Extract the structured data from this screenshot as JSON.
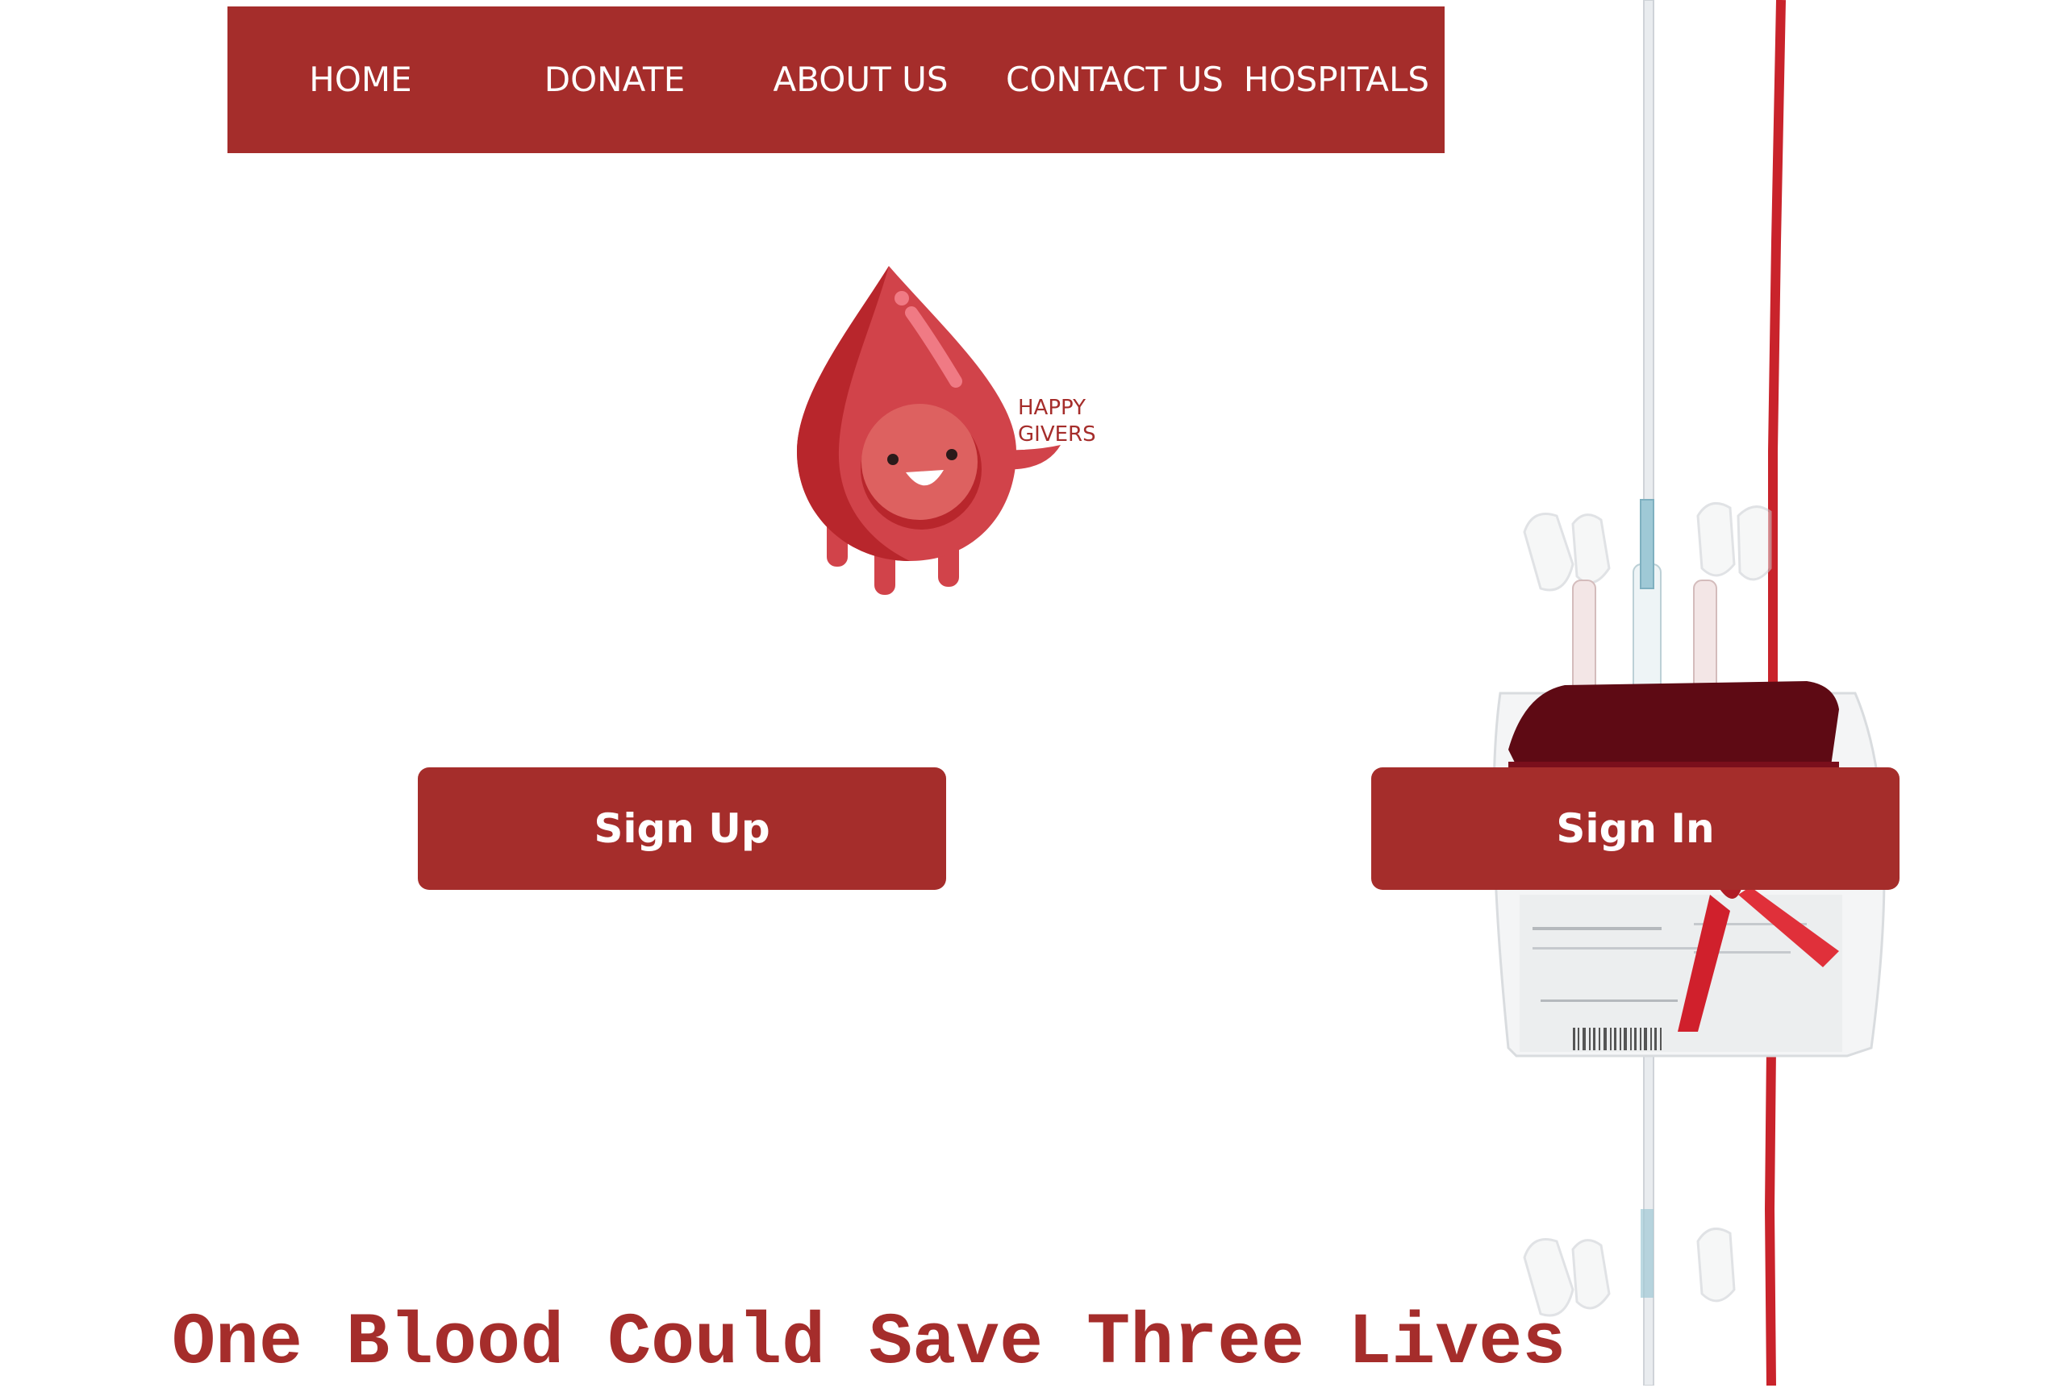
{
  "nav": {
    "items": [
      {
        "label": "HOME"
      },
      {
        "label": "DONATE"
      },
      {
        "label": "ABOUT US"
      },
      {
        "label": "CONTACT US"
      },
      {
        "label": "HOSPITALS"
      }
    ]
  },
  "logo": {
    "line1": "HAPPY",
    "line2": "GIVERS",
    "icon": "blood-drop-mascot-icon"
  },
  "actions": {
    "signup_label": "Sign Up",
    "signin_label": "Sign In"
  },
  "tagline": "One Blood Could Save Three Lives",
  "colors": {
    "brand": "#a52d2b",
    "drop": "#d1434a",
    "drop_dark": "#b8262c",
    "white": "#ffffff"
  }
}
